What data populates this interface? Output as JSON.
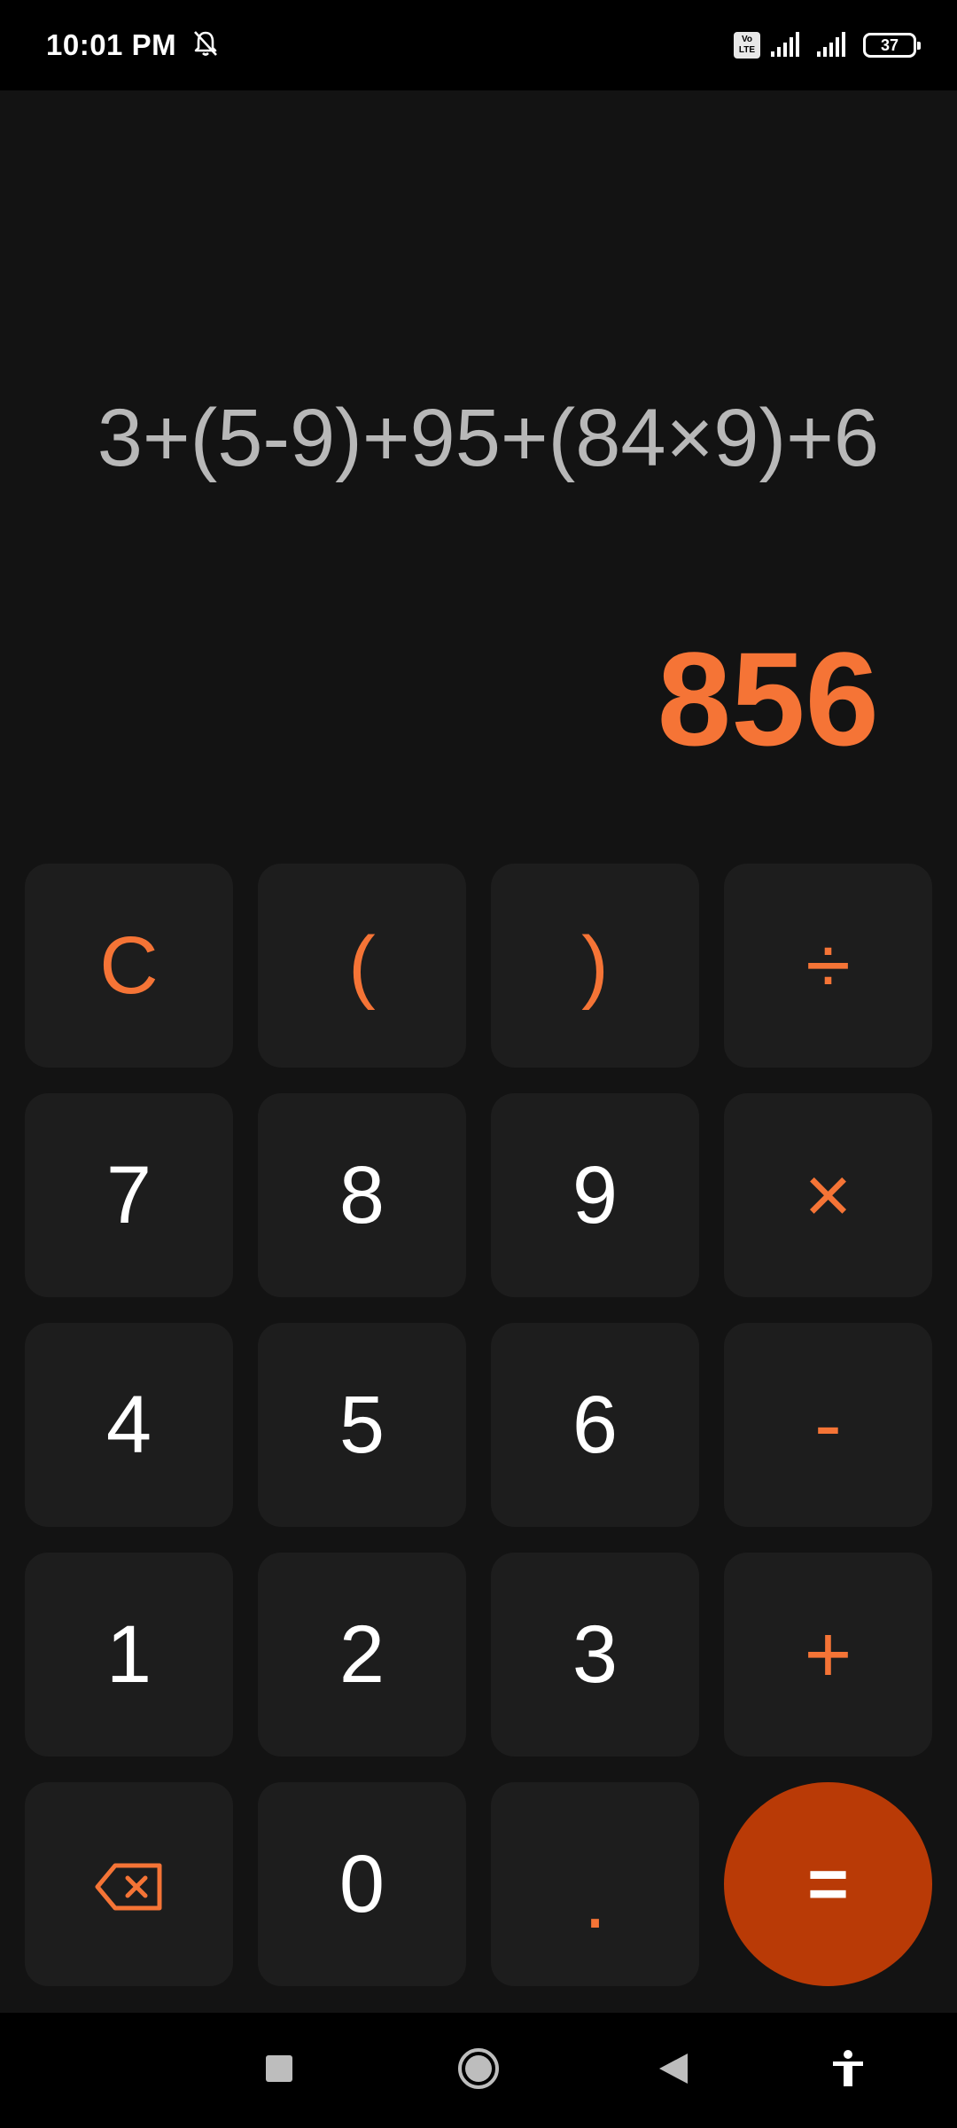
{
  "status_bar": {
    "time": "10:01 PM",
    "volte_label": "Vo LTE",
    "battery_level": "37"
  },
  "display": {
    "expression": "3+(5-9)+95+(84×9)+6",
    "result": "856"
  },
  "keys": {
    "clear": "C",
    "open_paren": "(",
    "close_paren": ")",
    "divide": "÷",
    "seven": "7",
    "eight": "8",
    "nine": "9",
    "multiply": "×",
    "four": "4",
    "five": "5",
    "six": "6",
    "subtract": "-",
    "one": "1",
    "two": "2",
    "three": "3",
    "add": "+",
    "zero": "0",
    "decimal": ".",
    "equals": "="
  },
  "icons": {
    "mute": "bell-off-icon",
    "signal": "signal-icon",
    "battery": "battery-icon",
    "backspace": "backspace-icon",
    "nav_recents": "recents-icon",
    "nav_home": "home-icon",
    "nav_back": "back-icon",
    "accessibility": "accessibility-icon"
  },
  "colors": {
    "accent": "#f57436",
    "equals_bg": "#b93a06",
    "key_bg": "#1d1d1d",
    "app_bg": "#131313",
    "expression_text": "#b8b8b8"
  }
}
